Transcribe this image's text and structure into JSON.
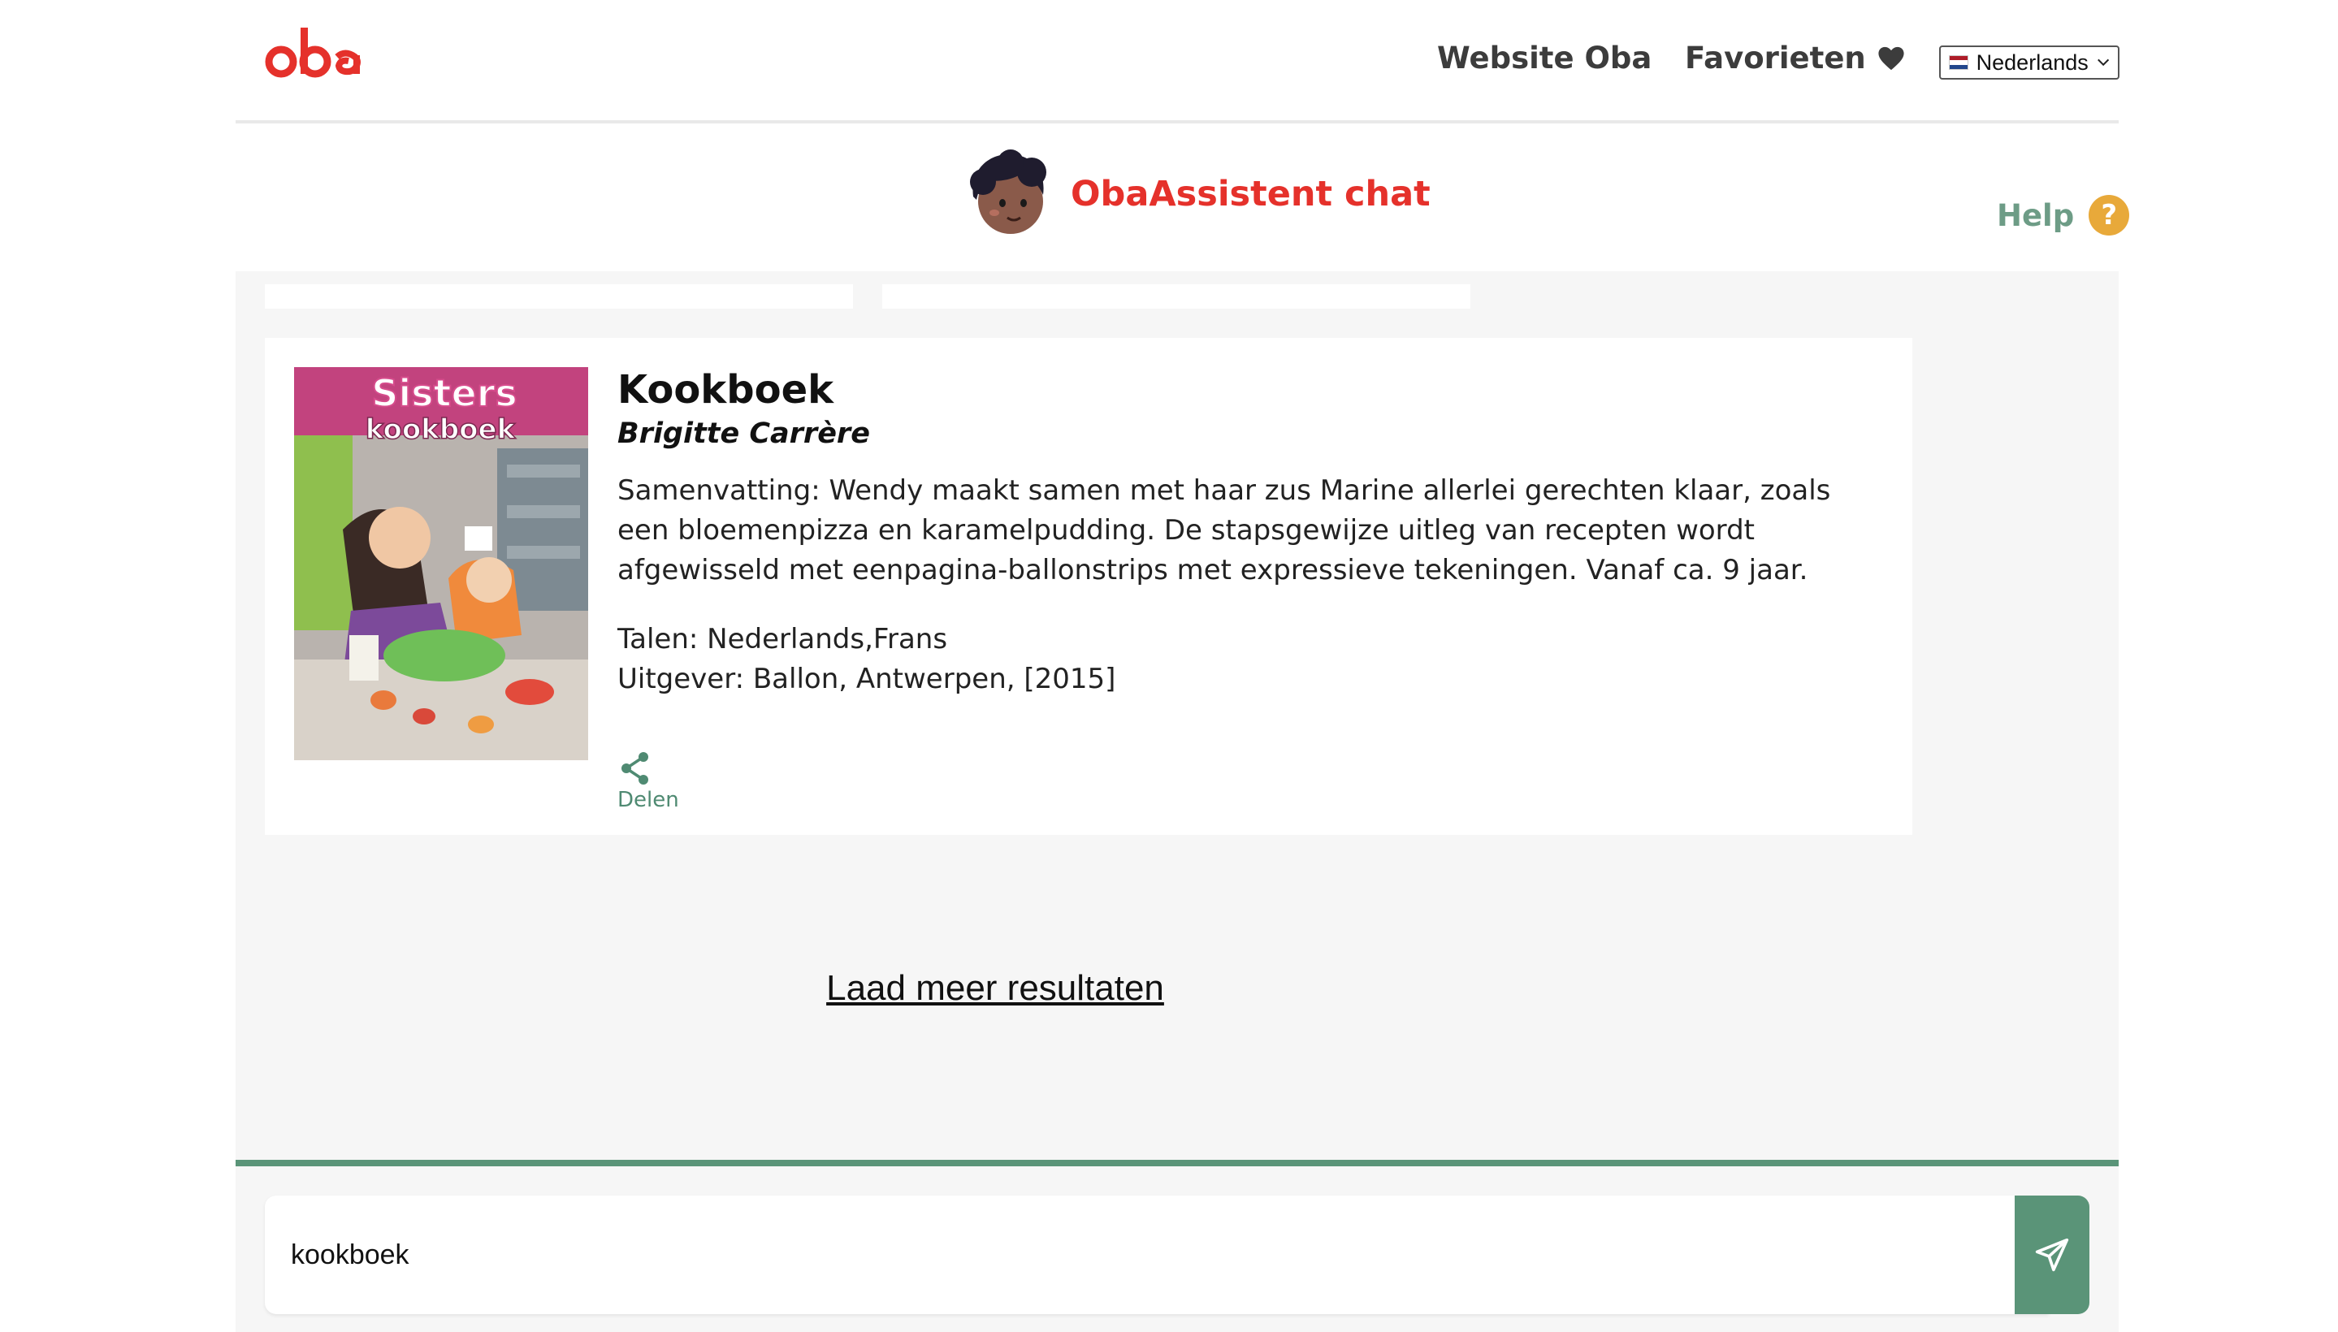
{
  "brand": {
    "logo_text": "oba",
    "accent_color": "#e5312b",
    "green_color": "#5a9478"
  },
  "nav": {
    "website_label": "Website Oba",
    "favorites_label": "Favorieten",
    "favorites_icon": "heart-icon",
    "language": {
      "selected": "Nederlands",
      "flag_icon": "netherlands-flag-icon"
    }
  },
  "assistant": {
    "title": "ObaAssistent chat",
    "avatar_icon": "assistant-avatar"
  },
  "help": {
    "label": "Help",
    "icon_text": "?"
  },
  "result": {
    "title": "Kookboek",
    "author": "Brigitte Carrère",
    "summary": "Samenvatting: Wendy maakt samen met haar zus Marine allerlei gerechten klaar, zoals een bloemenpizza en karamelpudding. De stapsgewijze uitleg van recepten wordt afgewisseld met eenpagina-ballonstrips met expressieve tekeningen. Vanaf ca. 9 jaar.",
    "languages": "Talen: Nederlands,Frans",
    "publisher": "Uitgever: Ballon, Antwerpen, [2015]",
    "share_label": "Delen",
    "cover": {
      "series": "Sisters",
      "subtitle": "kookboek"
    }
  },
  "load_more_label": "Laad meer resultaten",
  "chat_input": {
    "value": "kookboek"
  }
}
